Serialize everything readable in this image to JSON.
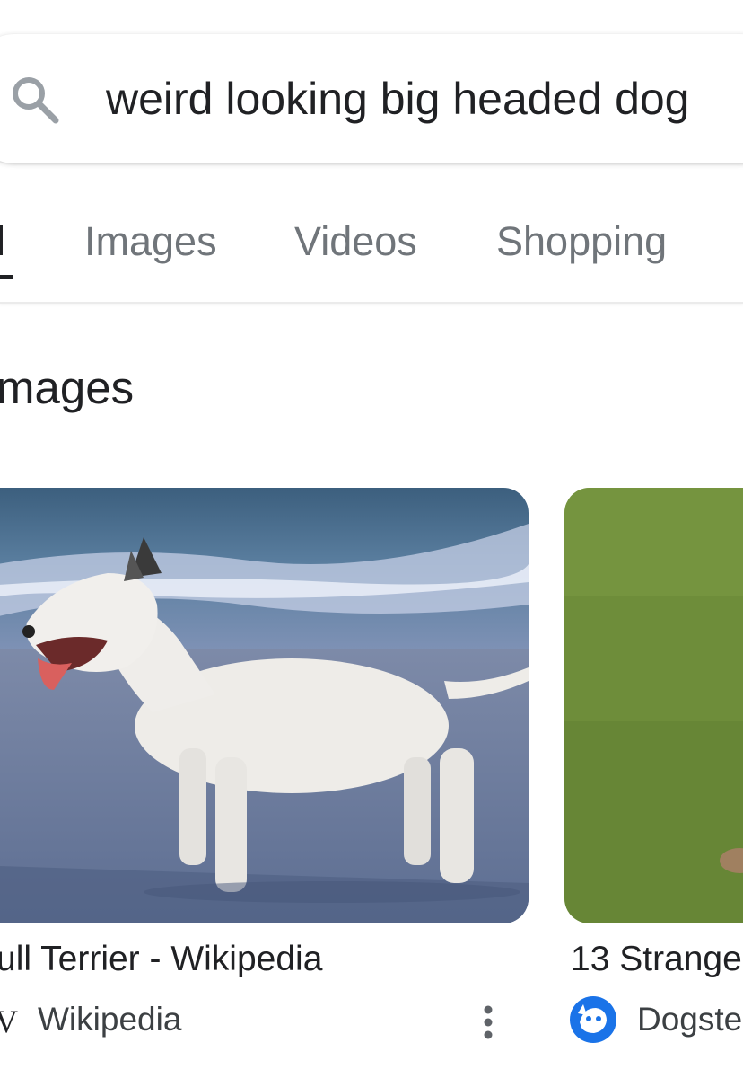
{
  "search": {
    "query": "weird looking big headed dog"
  },
  "tabs": [
    {
      "label": "l"
    },
    {
      "label": "Images"
    },
    {
      "label": "Videos"
    },
    {
      "label": "Shopping"
    }
  ],
  "section": {
    "title": "mages"
  },
  "results": [
    {
      "title": "ull Terrier - Wikipedia",
      "source_glyph": "V",
      "source": "Wikipedia"
    },
    {
      "title": "13 Strange",
      "source": "Dogste"
    }
  ],
  "colors": {
    "text_primary": "#202124",
    "text_secondary": "#70757a",
    "accent_blue": "#1a73e8"
  },
  "icons": {
    "search": "search-icon",
    "more": "more-vert-icon",
    "source_logo": "dogster-logo-icon"
  }
}
